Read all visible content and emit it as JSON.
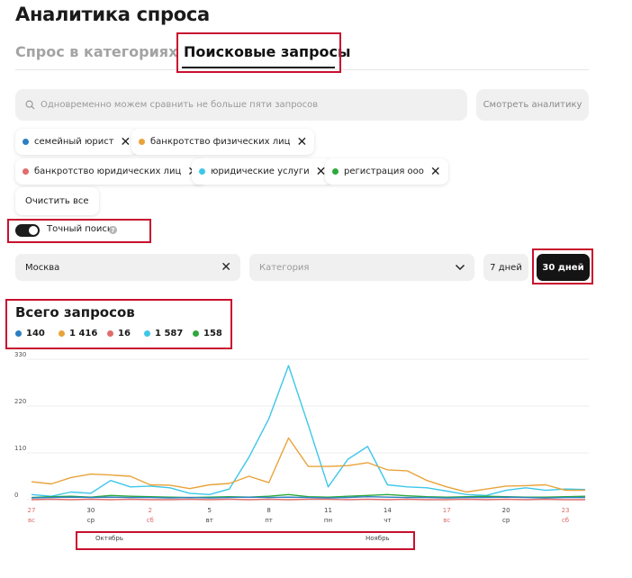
{
  "page": {
    "title": "Аналитика спроса"
  },
  "tabs": [
    {
      "label": "Спрос в категориях",
      "active": false
    },
    {
      "label": "Поисковые запросы",
      "active": true
    }
  ],
  "search": {
    "placeholder": "Одновременно можем сравнить не больше пяти запросов",
    "value": ""
  },
  "analytics_button": "Смотреть аналитику",
  "queries": [
    {
      "label": "семейный юрист",
      "color": "#2b7fc1"
    },
    {
      "label": "банкротство физических лиц",
      "color": "#e8a33a"
    },
    {
      "label": "банкротство юридических лиц",
      "color": "#e06c6c"
    },
    {
      "label": "юридические услуги",
      "color": "#3ec7e8"
    },
    {
      "label": "регистрация ооо",
      "color": "#2fa83b"
    }
  ],
  "clear_button": "Очистить все",
  "exact_search": {
    "label": "Точный поиск",
    "enabled": true,
    "help_icon": "?"
  },
  "filters": {
    "city": "Москва",
    "category_placeholder": "Категория",
    "periods": [
      {
        "label": "7 дней",
        "active": false
      },
      {
        "label": "30 дней",
        "active": true
      }
    ]
  },
  "totals": {
    "title": "Всего запросов",
    "items": [
      {
        "value": "140",
        "color": "#2b7fc1"
      },
      {
        "value": "1 416",
        "color": "#e8a33a"
      },
      {
        "value": "16",
        "color": "#e06c6c"
      },
      {
        "value": "1 587",
        "color": "#3ec7e8"
      },
      {
        "value": "158",
        "color": "#2fa83b"
      }
    ]
  },
  "chart_data": {
    "type": "line",
    "yticks": [
      "330",
      "220",
      "110",
      "0"
    ],
    "ylim": [
      0,
      330
    ],
    "x": [
      27,
      28,
      29,
      30,
      1,
      2,
      3,
      4,
      5,
      6,
      7,
      8,
      9,
      10,
      11,
      12,
      13,
      14,
      15,
      16,
      17,
      18,
      19,
      20,
      21,
      22,
      23,
      24,
      25
    ],
    "xticks": [
      {
        "index": 0,
        "day": "27",
        "weekday": "вс",
        "weekend": true
      },
      {
        "index": 3,
        "day": "30",
        "weekday": "ср",
        "weekend": false
      },
      {
        "index": 6,
        "day": "2",
        "weekday": "сб",
        "weekend": true
      },
      {
        "index": 9,
        "day": "5",
        "weekday": "вт",
        "weekend": false
      },
      {
        "index": 12,
        "day": "8",
        "weekday": "пт",
        "weekend": false
      },
      {
        "index": 15,
        "day": "11",
        "weekday": "пн",
        "weekend": false
      },
      {
        "index": 18,
        "day": "14",
        "weekday": "чт",
        "weekend": false
      },
      {
        "index": 21,
        "day": "17",
        "weekday": "вс",
        "weekend": true
      },
      {
        "index": 24,
        "day": "20",
        "weekday": "ср",
        "weekend": false
      },
      {
        "index": 27,
        "day": "23",
        "weekday": "сб",
        "weekend": true
      }
    ],
    "months": [
      {
        "label": "Октябрь",
        "index": 1.5
      },
      {
        "label": "Ноябрь",
        "index": 15.5
      }
    ],
    "series": [
      {
        "color": "#3ec7e8",
        "values": [
          12,
          8,
          18,
          15,
          45,
          30,
          32,
          28,
          15,
          12,
          25,
          100,
          190,
          315,
          175,
          30,
          95,
          125,
          35,
          30,
          28,
          20,
          12,
          10,
          22,
          28,
          22,
          25,
          24
        ]
      },
      {
        "color": "#e8a33a",
        "values": [
          42,
          37,
          52,
          60,
          58,
          55,
          35,
          34,
          26,
          35,
          38,
          55,
          40,
          145,
          78,
          78,
          80,
          87,
          70,
          68,
          45,
          30,
          18,
          25,
          32,
          33,
          35,
          22,
          22
        ]
      },
      {
        "color": "#2fa83b",
        "values": [
          5,
          7,
          8,
          6,
          10,
          8,
          7,
          6,
          5,
          6,
          7,
          6,
          8,
          12,
          7,
          6,
          8,
          10,
          12,
          9,
          7,
          6,
          7,
          8,
          7,
          6,
          6,
          7,
          8
        ]
      },
      {
        "color": "#2b7fc1",
        "values": [
          4,
          5,
          6,
          5,
          6,
          5,
          5,
          4,
          5,
          4,
          5,
          6,
          5,
          6,
          5,
          4,
          5,
          7,
          6,
          5,
          5,
          4,
          5,
          5,
          6,
          5,
          4,
          5,
          5
        ]
      },
      {
        "color": "#e06c6c",
        "values": [
          0,
          1,
          0,
          1,
          0,
          1,
          0,
          0,
          1,
          0,
          1,
          0,
          1,
          0,
          1,
          1,
          0,
          1,
          0,
          1,
          0,
          0,
          1,
          0,
          1,
          0,
          1,
          0,
          0
        ]
      }
    ]
  }
}
